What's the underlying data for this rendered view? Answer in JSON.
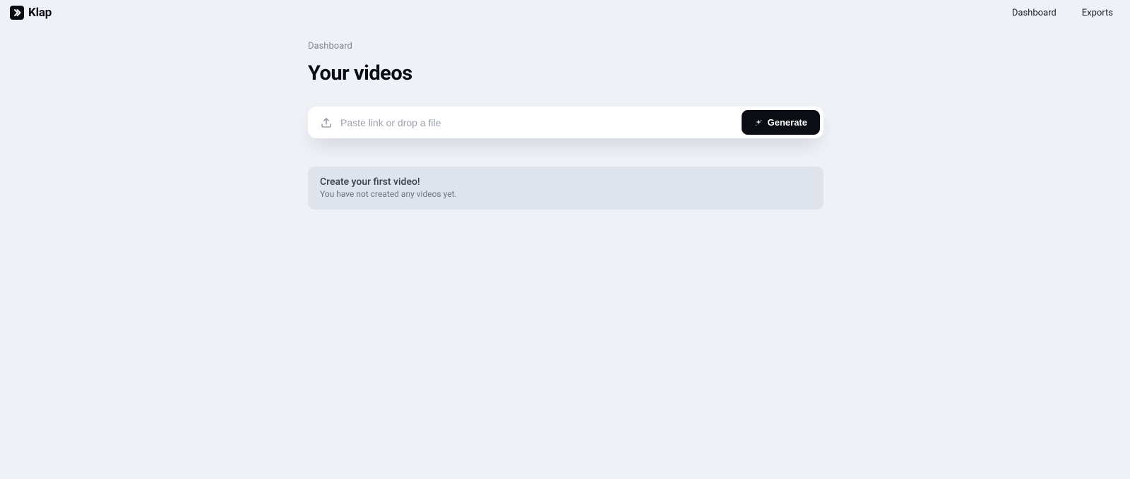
{
  "brand": {
    "name": "Klap"
  },
  "nav": {
    "dashboard": "Dashboard",
    "exports": "Exports"
  },
  "breadcrumb": "Dashboard",
  "page_title": "Your videos",
  "input": {
    "placeholder": "Paste link or drop a file"
  },
  "generate_button": "Generate",
  "empty_state": {
    "title": "Create your first video!",
    "subtitle": "You have not created any videos yet."
  }
}
